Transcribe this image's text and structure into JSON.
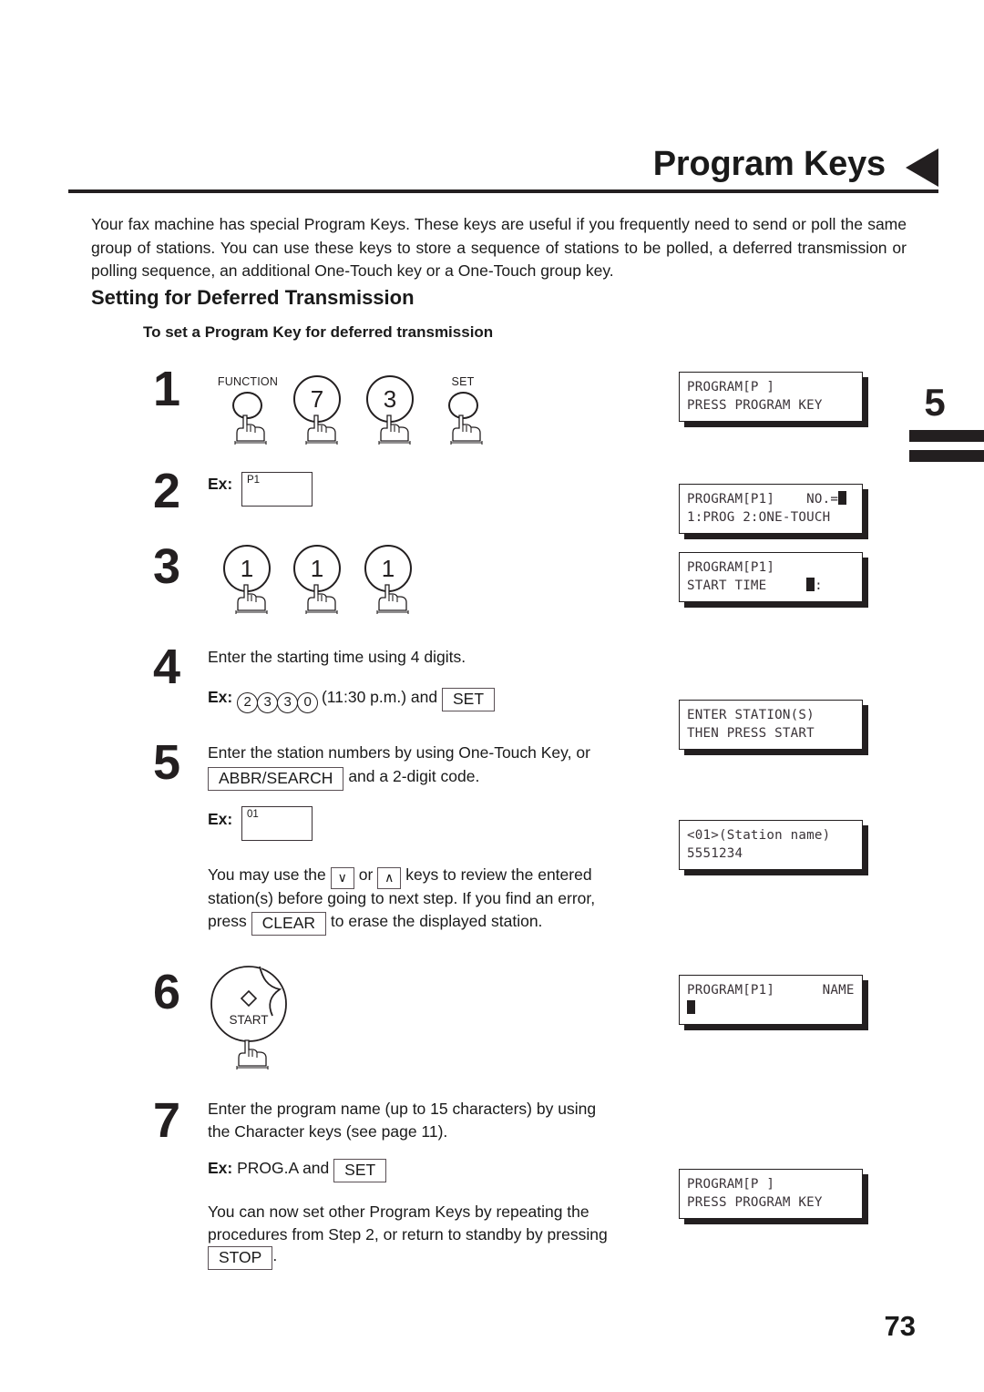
{
  "header": {
    "title": "Program Keys",
    "arrow_icon": "left-triangle-icon"
  },
  "chapter_tab": {
    "number": "5"
  },
  "intro_paragraph": "Your fax machine has special Program Keys.  These keys are useful if you frequently need to send or poll the same group of stations.  You can use these keys to store a sequence of stations to be polled, a deferred transmission or polling sequence, an additional One-Touch key or a One-Touch group key.",
  "section_heading": "Setting for Deferred Transmission",
  "sub_heading": "To set a Program Key for deferred transmission",
  "steps": {
    "s1": {
      "number": "1",
      "keys": [
        {
          "caption": "FUNCTION",
          "label": "",
          "type": "small"
        },
        {
          "caption": "",
          "label": "7",
          "type": "big"
        },
        {
          "caption": "",
          "label": "3",
          "type": "big"
        },
        {
          "caption": "SET",
          "label": "",
          "type": "small"
        }
      ]
    },
    "s2": {
      "number": "2",
      "ex_label": "Ex:",
      "key_label": "P1"
    },
    "s3": {
      "number": "3",
      "keys": [
        "1",
        "1",
        "1"
      ]
    },
    "s4": {
      "number": "4",
      "text": "Enter the starting time using 4 digits.",
      "ex_label": "Ex:",
      "digits": [
        "2",
        "3",
        "3",
        "0"
      ],
      "time_note": "(11:30 p.m.) and",
      "set_key": "SET"
    },
    "s5": {
      "number": "5",
      "text_line1": "Enter the station numbers by using One-Touch Key, or",
      "abbr_key": "ABBR/SEARCH",
      "text_line2": "and a 2-digit code.",
      "ex_label": "Ex:",
      "key_label": "01",
      "note_a": "You may use the",
      "down_key": "∨",
      "note_or": "or",
      "up_key": "∧",
      "note_b": "keys to review the entered",
      "note_c": "station(s) before going to next step. If you find an error,",
      "note_d": "press",
      "clear_key": "CLEAR",
      "note_e": "to erase the displayed station."
    },
    "s6": {
      "number": "6",
      "start_label": "START",
      "diamond_icon": "diamond-icon"
    },
    "s7": {
      "number": "7",
      "text_line1": "Enter the program name (up to 15 characters) by using",
      "text_line2": "the Character keys (see page 11).",
      "ex_label": "Ex:",
      "ex_value": "PROG.A and",
      "set_key": "SET",
      "closing_line1": "You can now set other Program Keys by repeating the",
      "closing_line2": "procedures from Step 2, or return to standby by pressing",
      "stop_key": "STOP",
      "closing_period": "."
    }
  },
  "displays": {
    "d1": {
      "line1": "PROGRAM[P ]",
      "line2": "PRESS PROGRAM KEY"
    },
    "d2": {
      "line1": "PROGRAM[P1]    NO.=",
      "line2": "1:PROG 2:ONE-TOUCH"
    },
    "d3": {
      "line1": "PROGRAM[P1]",
      "line2a": "START TIME     ",
      "line2b": ":"
    },
    "d4": {
      "line1": "ENTER STATION(S)",
      "line2": "THEN PRESS START"
    },
    "d5": {
      "line1": "<01>(Station name)",
      "line2": "5551234"
    },
    "d6": {
      "line1": "PROGRAM[P1]      NAME",
      "line2": ""
    },
    "d7": {
      "line1": "PROGRAM[P ]",
      "line2": "PRESS PROGRAM KEY"
    }
  },
  "page_number": "73"
}
